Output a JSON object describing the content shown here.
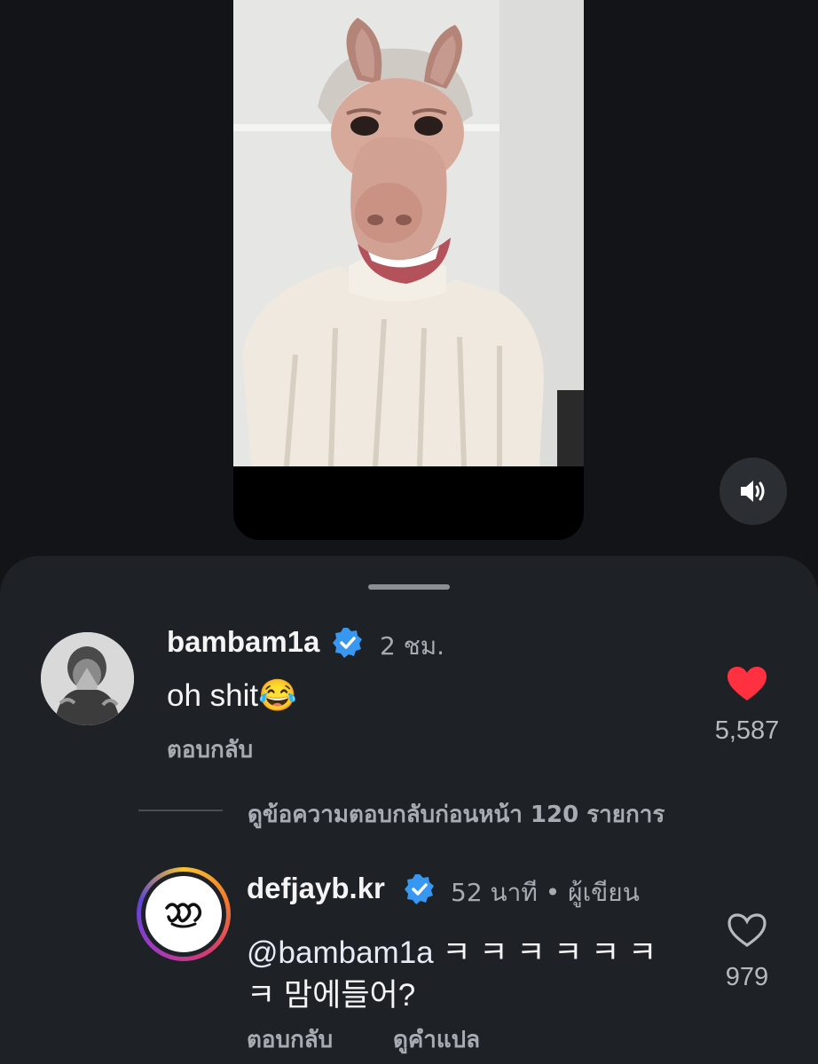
{
  "video": {
    "icon": "sound-on-icon"
  },
  "comments": [
    {
      "username": "bambam1a",
      "verified": true,
      "time": "2 ชม.",
      "text": "oh shit😂",
      "reply_label": "ตอบกลับ",
      "liked": true,
      "like_count": "5,587"
    }
  ],
  "view_replies_label": "ดูข้อความตอบกลับก่อนหน้า 120 รายการ",
  "replies": [
    {
      "username": "defjayb.kr",
      "verified": true,
      "meta": "52 นาที • ผู้เขียน",
      "mention": "@bambam1a",
      "text_line1": "ㅋ ㅋ ㅋ ㅋ ㅋ ㅋ",
      "text_line2": "ㅋ 맘에들어?",
      "reply_label": "ตอบกลับ",
      "translate_label": "ดูคำแปล",
      "liked": false,
      "like_count": "979"
    }
  ],
  "colors": {
    "background": "#121418",
    "sheet": "#1e2126",
    "verified_blue": "#3897f0",
    "heart_red": "#ff3040",
    "muted_text": "#a8acb2"
  }
}
